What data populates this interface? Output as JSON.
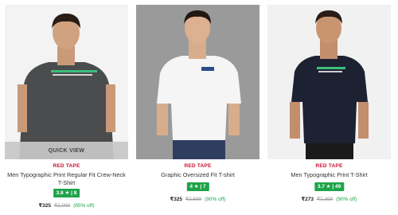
{
  "products": [
    {
      "brand": "RED TAPE",
      "title": "Men Typographic Print Regular Fit Crew-Neck T-Shirt",
      "rating": "3.8",
      "star": "★",
      "sep": "|",
      "reviews": "8",
      "price": "₹325",
      "mrp": "₹2,099",
      "off": "(85% off)",
      "quick_view": "QUICK VIEW",
      "shirt_color": "#4a4c4d",
      "icon": "model-photo-icon"
    },
    {
      "brand": "RED TAPE",
      "title": "Graphic Oversized Fit T-shirt",
      "rating": "4",
      "star": "★",
      "sep": "|",
      "reviews": "7",
      "price": "₹325",
      "mrp": "₹2,699",
      "off": "(90% off)",
      "shirt_color": "#f5f5f5",
      "icon": "model-photo-icon"
    },
    {
      "brand": "RED TAPE",
      "title": "Men Typographic Print T-Shirt",
      "rating": "3.7",
      "star": "★",
      "sep": "|",
      "reviews": "49",
      "price": "₹273",
      "mrp": "₹2,399",
      "off": "(90% off)",
      "shirt_color": "#1d2233",
      "icon": "model-photo-icon"
    }
  ],
  "colors": {
    "brand_red": "#c8102e",
    "rating_green": "#1fa34a"
  }
}
